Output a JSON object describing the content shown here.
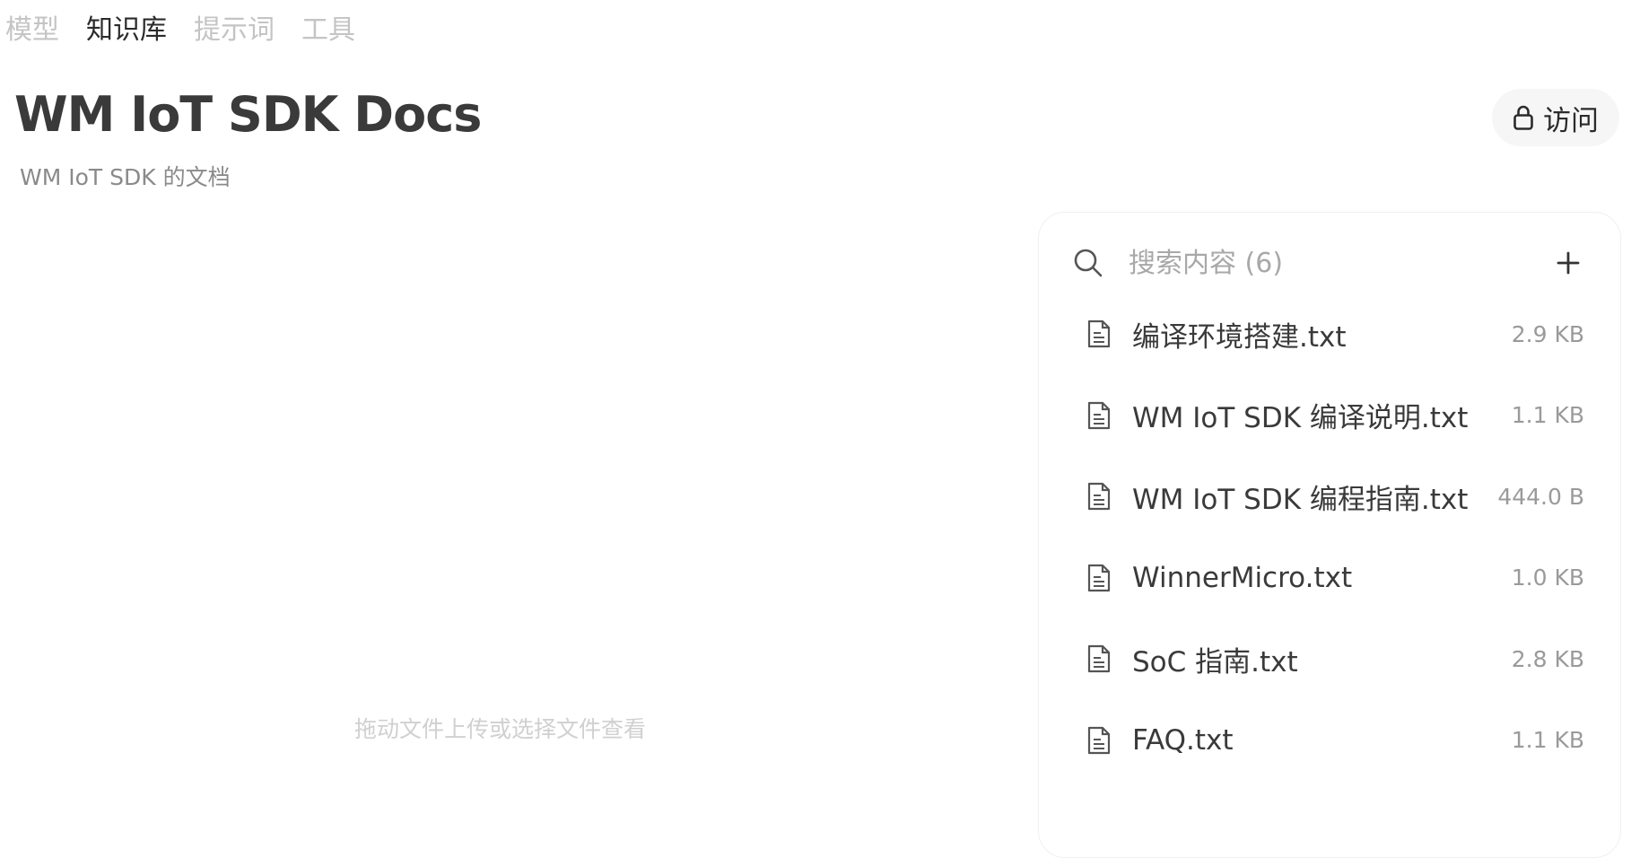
{
  "nav": {
    "tabs": [
      {
        "label": "模型",
        "active": false
      },
      {
        "label": "知识库",
        "active": true
      },
      {
        "label": "提示词",
        "active": false
      },
      {
        "label": "工具",
        "active": false
      }
    ]
  },
  "header": {
    "title": "WM IoT SDK Docs",
    "subtitle": "WM IoT SDK 的文档",
    "access_button": {
      "label": "访问",
      "icon": "lock-icon"
    }
  },
  "drop_zone": {
    "hint": "拖动文件上传或选择文件查看"
  },
  "panel": {
    "search": {
      "placeholder": "搜索内容 (6)",
      "value": "",
      "icon": "search-icon"
    },
    "add_icon": "plus-icon",
    "files": [
      {
        "name": "编译环境搭建.txt",
        "size": "2.9 KB",
        "icon": "document-icon"
      },
      {
        "name": "WM IoT SDK 编译说明.txt",
        "size": "1.1 KB",
        "icon": "document-icon"
      },
      {
        "name": "WM IoT SDK 编程指南.txt",
        "size": "444.0 B",
        "icon": "document-icon"
      },
      {
        "name": "WinnerMicro.txt",
        "size": "1.0 KB",
        "icon": "document-icon"
      },
      {
        "name": "SoC 指南.txt",
        "size": "2.8 KB",
        "icon": "document-icon"
      },
      {
        "name": "FAQ.txt",
        "size": "1.1 KB",
        "icon": "document-icon"
      }
    ]
  },
  "colors": {
    "tab_inactive": "#c4c4c4",
    "tab_active": "#2b2b2b",
    "title": "#3a3a3a",
    "subtitle": "#8a8a8a",
    "muted": "#a8a8a8",
    "button_bg": "#f6f6f6"
  }
}
